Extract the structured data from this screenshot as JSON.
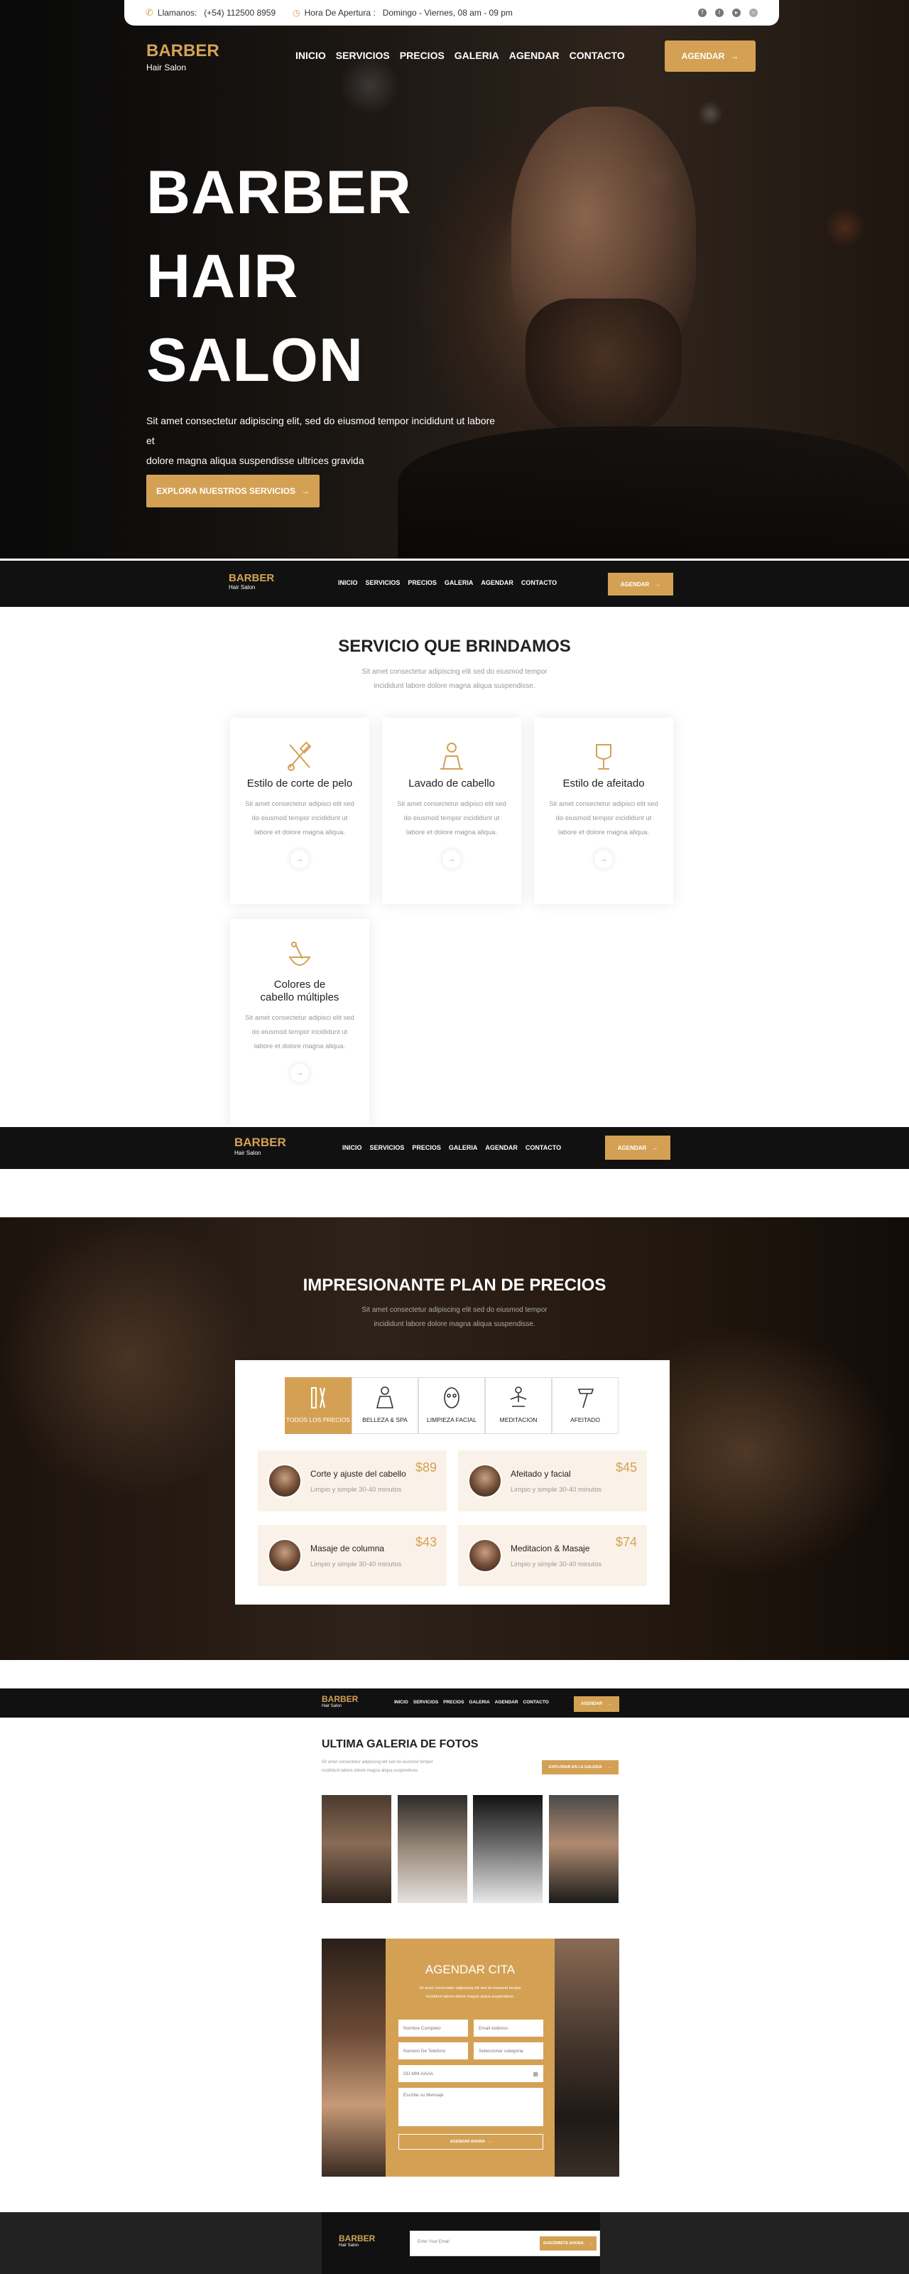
{
  "topbar": {
    "call_label": "Llamanos:",
    "phone": "(+54) 112500 8959",
    "hours_label": "Hora De Apertura :",
    "hours": "Domingo - Viernes, 08 am - 09 pm",
    "social": [
      "facebook-icon",
      "twitter-icon",
      "youtube-icon",
      "instagram-icon"
    ]
  },
  "brand": {
    "title": "BARBER",
    "subtitle": "Hair Salon"
  },
  "nav": {
    "links": [
      "INICIO",
      "SERVICIOS",
      "PRECIOS",
      "GALERIA",
      "AGENDAR",
      "CONTACTO"
    ],
    "cta": "AGENDAR"
  },
  "hero": {
    "title_line1": "BARBER",
    "title_line2": "HAIR",
    "title_line3": "SALON",
    "desc_line1": "Sit amet consectetur adipiscing elit, sed do eiusmod tempor incididunt ut labore et",
    "desc_line2": "dolore magna aliqua suspendisse ultrices gravida",
    "button": "EXPLORA NUESTROS SERVICIOS"
  },
  "services": {
    "title": "SERVICIO QUE BRINDAMOS",
    "sub_line1": "Sit amet consectetur adipiscing elit sed do eiusmod tempor",
    "sub_line2": "incididunt labore dolore magna aliqua suspendisse.",
    "cards": [
      {
        "title": "Estilo de corte de pelo",
        "desc": "Sit amet consectetur adipisci elit sed do eiusmod tempor incididunt ut labore et dolore magna aliqua.",
        "icon": "scissors-comb-icon"
      },
      {
        "title": "Lavado de cabello",
        "desc": "Sit amet consectetur adipisci elit sed do eiusmod tempor incididunt ut labore et dolore magna aliqua.",
        "icon": "hair-wash-icon"
      },
      {
        "title": "Estilo de afeitado",
        "desc": "Sit amet consectetur adipisci elit sed do eiusmod tempor incididunt ut labore et dolore magna aliqua.",
        "icon": "shaving-icon"
      },
      {
        "title": "Colores de cabello múltiples",
        "desc": "Sit amet consectetur adipisci elit sed do eiusmod tempor incididunt ut labore et dolore magna aliqua.",
        "icon": "hair-color-icon"
      }
    ]
  },
  "pricing": {
    "title": "IMPRESIONANTE PLAN DE PRECIOS",
    "sub_line1": "Sit amet consectetur adipiscing elit sed do eiusmod tempor",
    "sub_line2": "incididunt labore dolore magna aliqua suspendisse.",
    "tabs": [
      "TODOS LOS PRECIOS",
      "BELLEZA & SPA",
      "LIMPIEZA FACIAL",
      "MEDITACION",
      "AFEITADO"
    ],
    "items": [
      {
        "name": "Corte y ajuste del cabello",
        "desc": "Limpio y simple 30-40 minutos",
        "price": "$89"
      },
      {
        "name": "Afeitado y facial",
        "desc": "Limpio y simple 30-40 minutos",
        "price": "$45"
      },
      {
        "name": "Masaje de columna",
        "desc": "Limpio y simple 30-40 minutos",
        "price": "$43"
      },
      {
        "name": "Meditacion & Masaje",
        "desc": "Limpio y simple 30-40 minutos",
        "price": "$74"
      }
    ]
  },
  "gallery": {
    "title": "ULTIMA GALERIA DE FOTOS",
    "sub_line1": "Sit amet consectetur adipiscing elit sed do eiusmod tempor",
    "sub_line2": "incididunt labore dolore magna aliqua suspendisse.",
    "button": "EXPLORAR EN LA GALERIA"
  },
  "booking": {
    "title": "AGENDAR CITA",
    "sub_line1": "Sit amet consectetur adipiscing elit sed do eiusmod tempor",
    "sub_line2": "incididunt labore dolore magna aliqua suspendisse.",
    "name_placeholder": "Nombre Completo",
    "email_placeholder": "Email Address",
    "phone_placeholder": "Numero De Telefono",
    "category_placeholder": "Seleccionar categoria",
    "date_placeholder": "DD-MM-AAAA",
    "message_placeholder": "Escribe su Mensaje",
    "submit": "AGENDAR AHORA"
  },
  "footer": {
    "email_placeholder": "Enter Your Email",
    "subscribe": "SUSCRIBETE AHORA"
  },
  "colors": {
    "accent": "#d4a154",
    "dark": "#111111"
  }
}
